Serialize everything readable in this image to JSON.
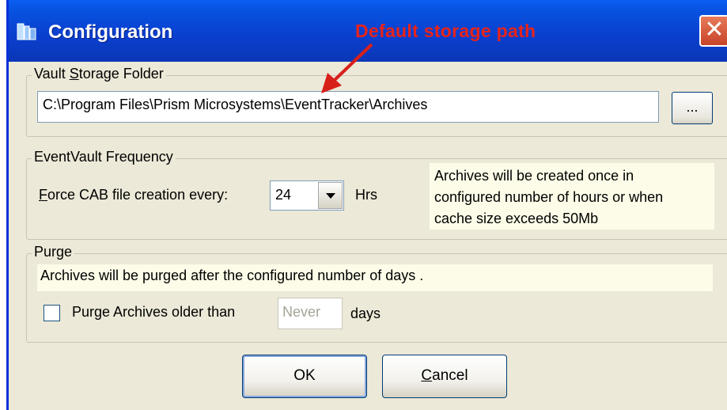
{
  "window": {
    "title": "Configuration",
    "close_glyph": "✕"
  },
  "annotation": {
    "text": "Default storage path",
    "color": "#e8231a"
  },
  "vault": {
    "legend": "Vault Storage Folder",
    "legend_access_key": "S",
    "path_value": "C:\\Program Files\\Prism Microsystems\\EventTracker\\Archives",
    "browse_label": "..."
  },
  "frequency": {
    "legend": "EventVault Frequency",
    "label": "Force CAB file creation every:",
    "label_access_key": "F",
    "selected_value": "24",
    "unit": "Hrs",
    "info_lines": [
      "Archives will be created once in",
      "configured number of hours or when",
      "cache size exceeds 50Mb"
    ]
  },
  "purge": {
    "legend": "Purge",
    "info": "Archives will be purged after the configured number of days .",
    "checkbox_label": "Purge Archives older than",
    "checkbox_checked": false,
    "days_value": "Never",
    "days_unit": "days"
  },
  "buttons": {
    "ok": "OK",
    "cancel": "Cancel",
    "cancel_access_key": "C"
  },
  "colors": {
    "titlebar": "#0a3ecd",
    "dialog_bg": "#ece9d8",
    "info_bg": "#fdfce8"
  }
}
